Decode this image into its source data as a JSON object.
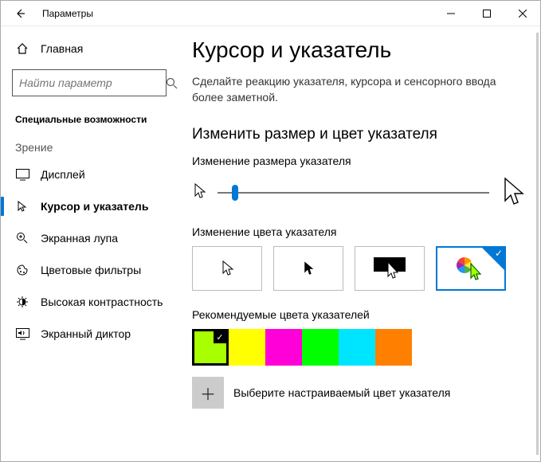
{
  "window": {
    "title": "Параметры"
  },
  "sidebar": {
    "home": "Главная",
    "search_placeholder": "Найти параметр",
    "category": "Специальные возможности",
    "group": "Зрение",
    "items": [
      {
        "label": "Дисплей"
      },
      {
        "label": "Курсор и указатель"
      },
      {
        "label": "Экранная лупа"
      },
      {
        "label": "Цветовые фильтры"
      },
      {
        "label": "Высокая контрастность"
      },
      {
        "label": "Экранный диктор"
      }
    ]
  },
  "main": {
    "title": "Курсор и указатель",
    "description": "Сделайте реакцию указателя, курсора и сенсорного ввода более заметной.",
    "section1": "Изменить размер и цвет указателя",
    "size_label": "Изменение размера указателя",
    "color_label": "Изменение цвета указателя",
    "recommended_label": "Рекомендуемые цвета указателей",
    "custom_color": "Выберите настраиваемый цвет указателя",
    "swatches": [
      "#a8ff00",
      "#ffff00",
      "#ff00d8",
      "#00ff00",
      "#00e5ff",
      "#ff8000"
    ],
    "selected_swatch": 0,
    "selected_option": 3
  }
}
